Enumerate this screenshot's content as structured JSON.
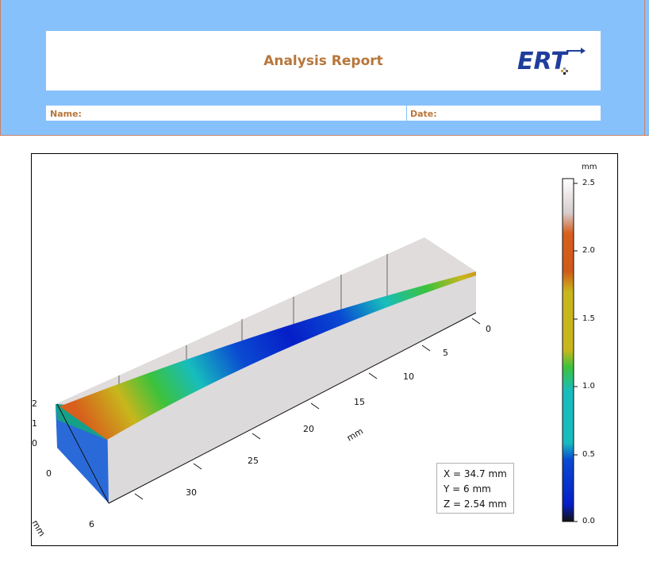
{
  "report": {
    "title": "Analysis Report",
    "logo_text": "ERT",
    "name_label": "Name:",
    "date_label": "Date:"
  },
  "colors": {
    "header_band": "#87c1fb",
    "title_text": "#b8763a",
    "logo_blue": "#1f3e9c"
  },
  "readout": {
    "x": "X = 34.7 mm",
    "y": "Y = 6 mm",
    "z": "Z = 2.54 mm"
  },
  "colorbar": {
    "unit": "mm",
    "ticks": [
      "2.5",
      "2.0",
      "1.5",
      "1.0",
      "0.5",
      "0.0"
    ]
  },
  "axes": {
    "y_axis_ticks": [
      "0",
      "5",
      "10",
      "15",
      "20",
      "25",
      "30"
    ],
    "y_axis_label": "mm",
    "x_axis_ticks": [
      "0",
      "6"
    ],
    "x_axis_label": "mm",
    "z_axis_ticks": [
      "2",
      "1",
      "0"
    ]
  }
}
